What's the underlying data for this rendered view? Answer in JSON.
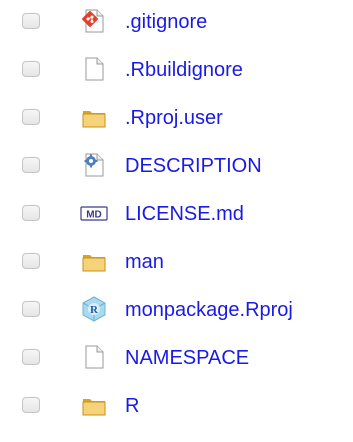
{
  "files": [
    {
      "name": ".gitignore",
      "icon": "git-file-icon",
      "color": "#1a1ae6"
    },
    {
      "name": ".Rbuildignore",
      "icon": "blank-file-icon",
      "color": "#1a1ae6"
    },
    {
      "name": ".Rproj.user",
      "icon": "folder-icon",
      "color": "#1a1ae6"
    },
    {
      "name": "DESCRIPTION",
      "icon": "description-file-icon",
      "color": "#1a1ae6"
    },
    {
      "name": "LICENSE.md",
      "icon": "markdown-file-icon",
      "color": "#1a1ae6"
    },
    {
      "name": "man",
      "icon": "folder-icon",
      "color": "#1a1ae6"
    },
    {
      "name": "monpackage.Rproj",
      "icon": "rproject-file-icon",
      "color": "#1a1ae6"
    },
    {
      "name": "NAMESPACE",
      "icon": "blank-file-icon",
      "color": "#1a1ae6"
    },
    {
      "name": "R",
      "icon": "folder-icon",
      "color": "#1a1ae6"
    }
  ]
}
